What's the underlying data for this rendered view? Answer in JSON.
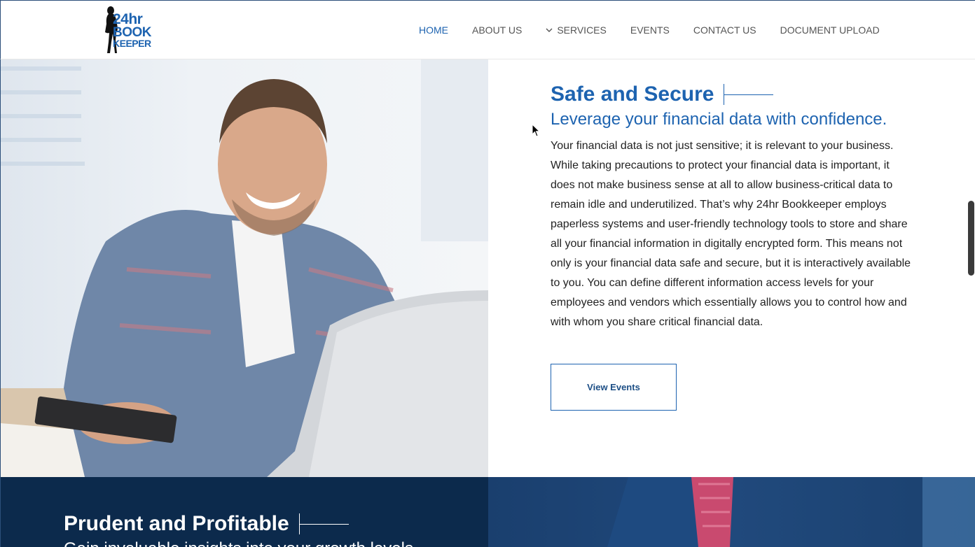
{
  "header": {
    "logo": {
      "line1": "24hr",
      "line2": "BOOK",
      "line3": "KEEPER"
    },
    "nav": [
      {
        "label": "HOME",
        "active": true
      },
      {
        "label": "ABOUT US",
        "active": false
      },
      {
        "label": "SERVICES",
        "active": false,
        "icon": "chevron-down-icon"
      },
      {
        "label": "EVENTS",
        "active": false
      },
      {
        "label": "CONTACT US",
        "active": false
      },
      {
        "label": "DOCUMENT UPLOAD",
        "active": false
      }
    ]
  },
  "section": {
    "title": "Safe and Secure",
    "subtitle": "Leverage your financial data with confidence.",
    "body": "Your financial data is not just sensitive; it is relevant to your business. While taking precautions to protect your financial data is important, it does not make business sense at all to allow business-critical data to remain idle and underutilized. That’s why 24hr Bookkeeper employs paperless systems and user-friendly technology tools to store and share all your financial information in digitally encrypted form. This means not only is your financial data safe and secure, but it is interactively available to you. You can define different information access levels for your employees and vendors which essentially allows you to control how and with whom you share critical financial data.",
    "button_label": "View Events"
  },
  "next_section": {
    "title": "Prudent and Profitable",
    "subtitle": "Gain invaluable insights into your growth levels"
  },
  "colors": {
    "brand_blue": "#1d63b0",
    "navy": "#0c2a4c",
    "text": "#222222",
    "nav_text": "#555555"
  }
}
